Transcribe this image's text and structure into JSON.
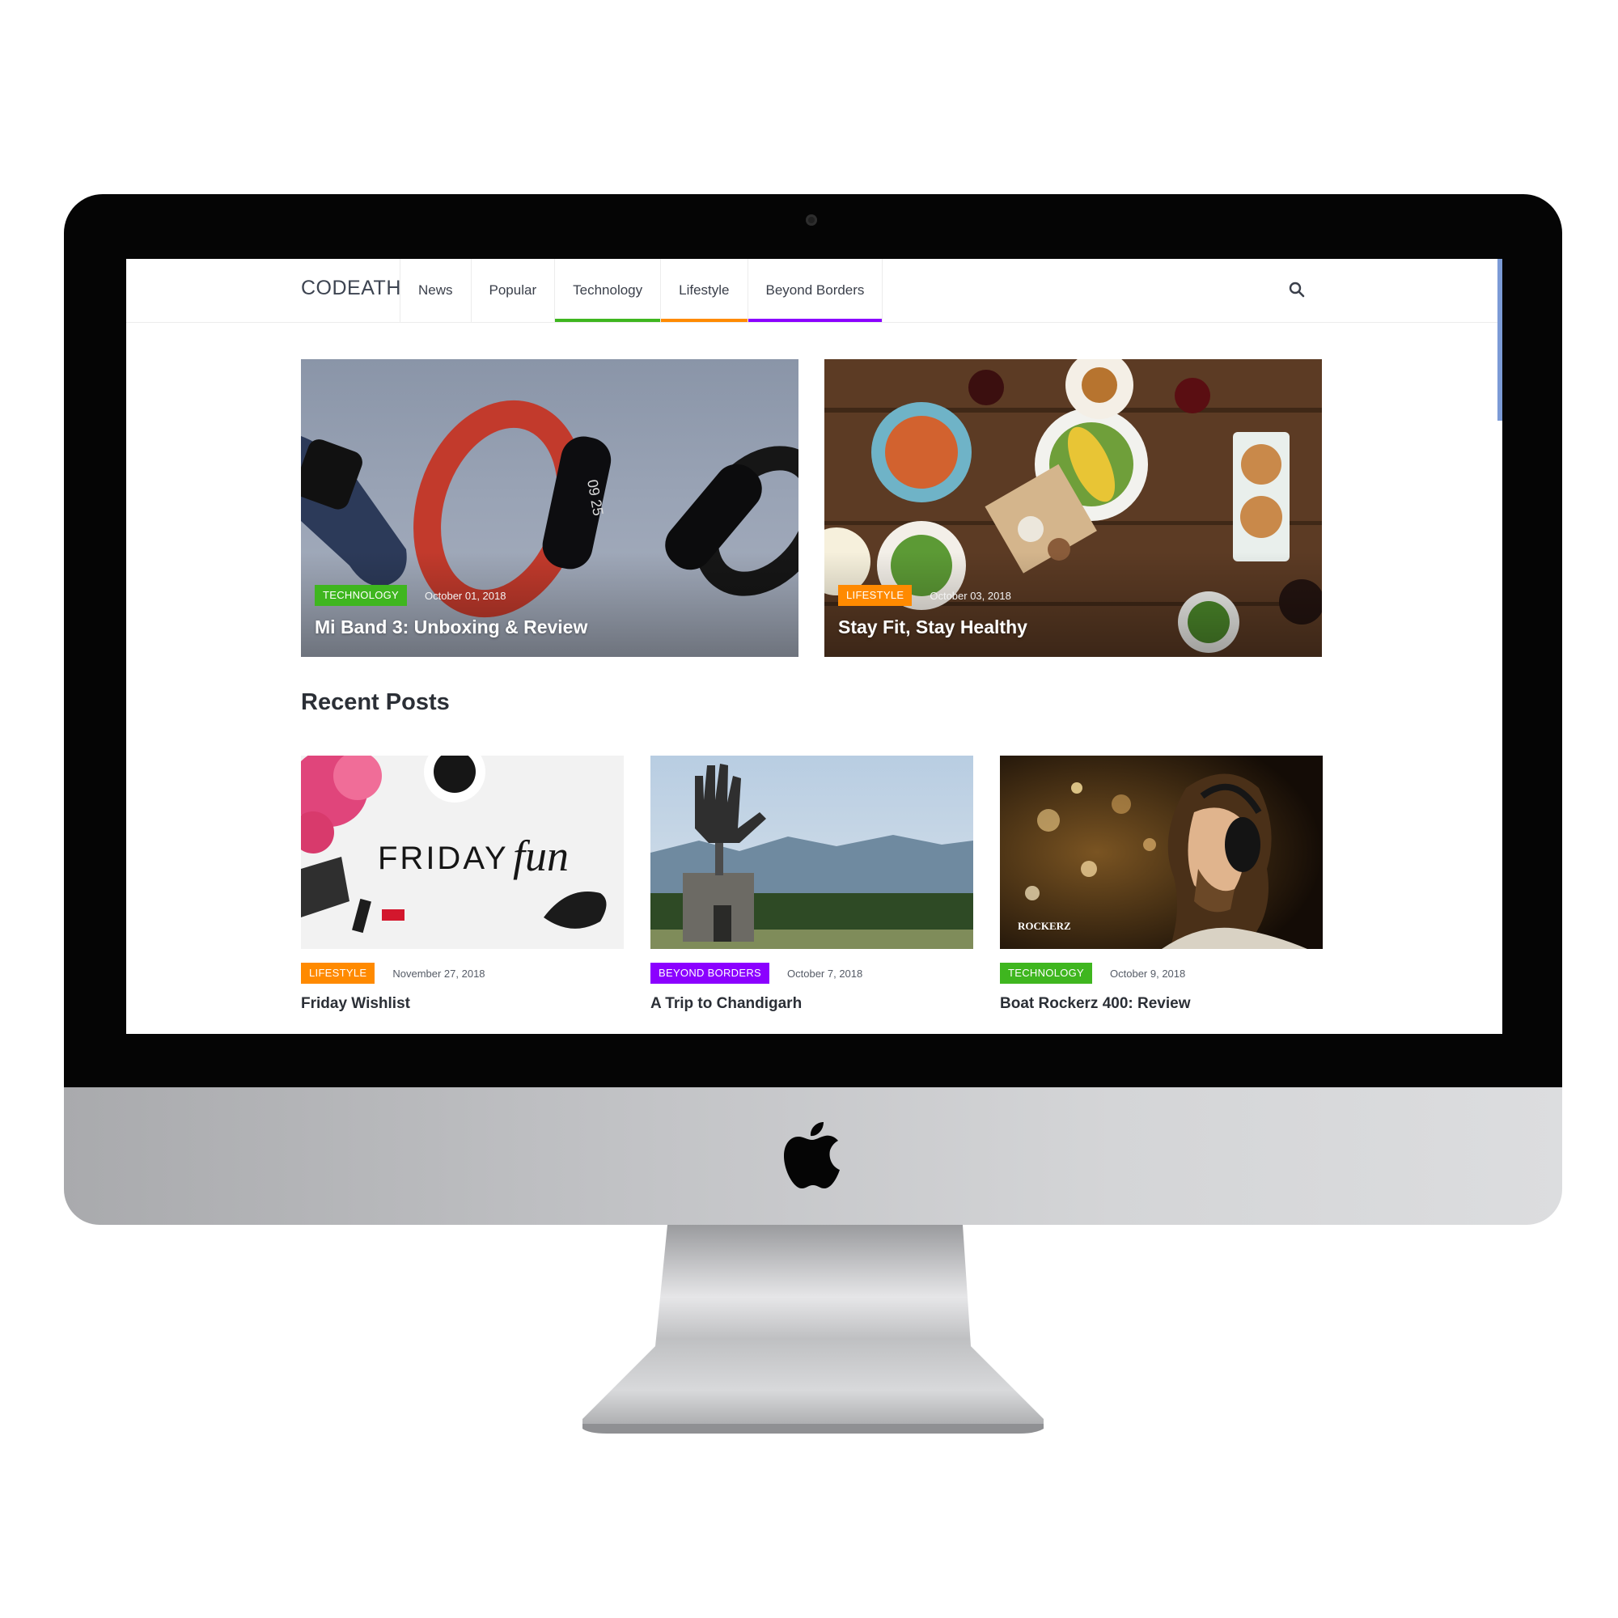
{
  "brand": "CODEATH",
  "nav": [
    {
      "label": "News",
      "underline": ""
    },
    {
      "label": "Popular",
      "underline": ""
    },
    {
      "label": "Technology",
      "underline": "#3fb61f"
    },
    {
      "label": "Lifestyle",
      "underline": "#ff8a00"
    },
    {
      "label": "Beyond Borders",
      "underline": "#8b00ff"
    }
  ],
  "colors": {
    "technology": "#3fb61f",
    "lifestyle": "#ff8a00",
    "beyond_borders": "#8b00ff"
  },
  "featured": [
    {
      "category": "TECHNOLOGY",
      "date": "October 01, 2018",
      "title": "Mi Band 3: Unboxing & Review",
      "image": "fitness-band-image"
    },
    {
      "category": "LIFESTYLE",
      "date": "October 03, 2018",
      "title": "Stay Fit, Stay Healthy",
      "image": "food-table-image"
    }
  ],
  "recent": {
    "heading": "Recent Posts",
    "posts": [
      {
        "category": "LIFESTYLE",
        "date": "November 27, 2018",
        "title": "Friday Wishlist",
        "image_text": "FRIDAY",
        "image_script": "fun"
      },
      {
        "category": "BEYOND BORDERS",
        "date": "October 7, 2018",
        "title": "A Trip to Chandigarh",
        "image": "open-hand-monument-image"
      },
      {
        "category": "TECHNOLOGY",
        "date": "October 9, 2018",
        "title": "Boat Rockerz 400: Review",
        "image_text": "ROCKERZ"
      }
    ]
  },
  "icons": {
    "search": "search-icon",
    "apple": "apple-logo-icon"
  }
}
